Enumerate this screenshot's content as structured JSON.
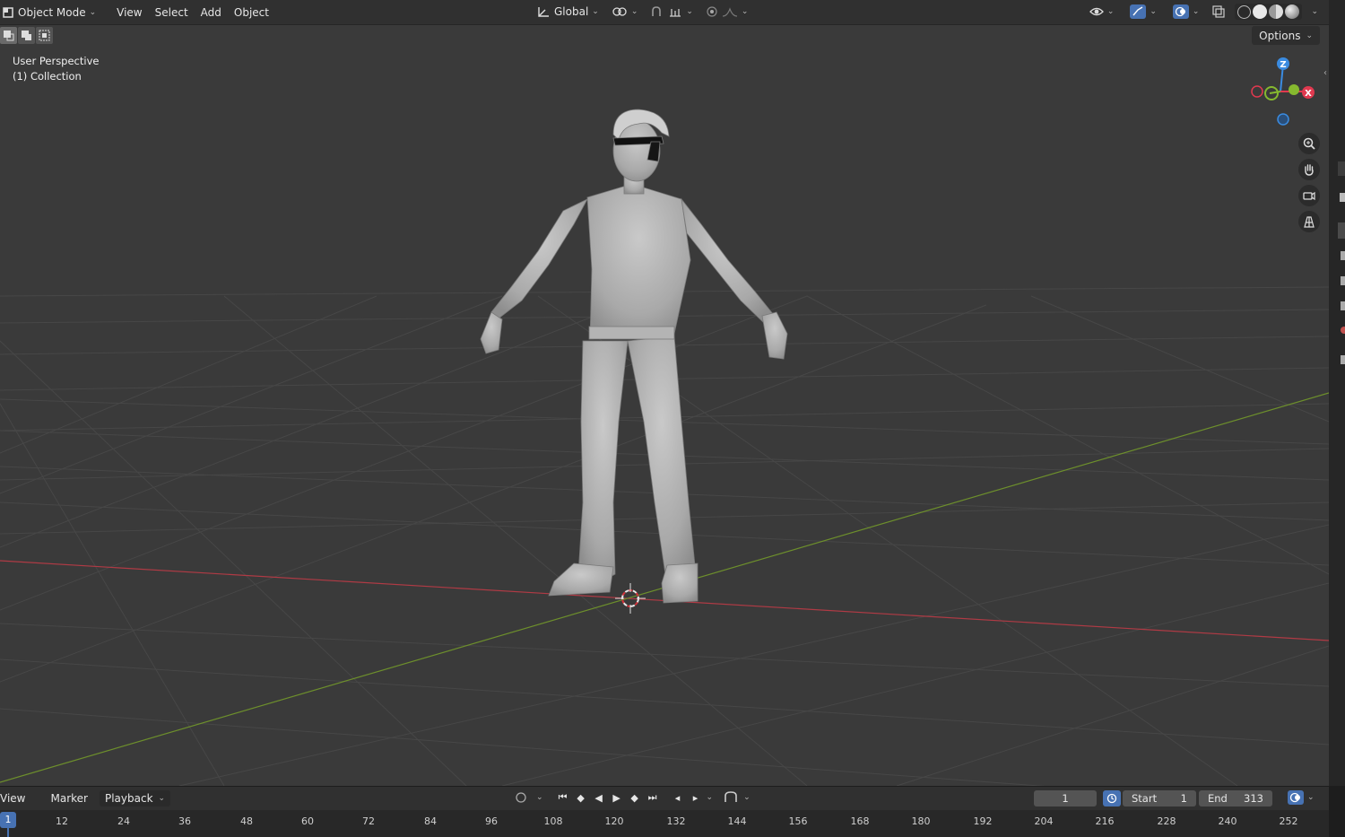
{
  "header": {
    "mode_label": "Object Mode",
    "menus": [
      "View",
      "Select",
      "Add",
      "Object"
    ],
    "transform_orientation": "Global"
  },
  "options_label": "Options",
  "viewport_info": {
    "perspective": "User Perspective",
    "collection": "(1) Collection"
  },
  "gizmo": {
    "z": "Z",
    "x": "X"
  },
  "colors": {
    "x_axis": "#e0394f",
    "y_axis": "#86b92f",
    "z_axis": "#3a8be0",
    "accent": "#4772b3"
  },
  "icons": [
    "cube-icon",
    "transform-orientation-icon",
    "pivot-icon",
    "snap-icon",
    "proportional-edit-icon",
    "visibility-icon",
    "gizmo-icon",
    "overlay-icon",
    "xray-icon",
    "zoom-icon",
    "pan-hand-icon",
    "camera-icon",
    "ortho-grid-icon",
    "clock-icon"
  ],
  "timeline": {
    "menus": [
      "View",
      "Marker"
    ],
    "playback_label": "Playback",
    "current_frame": "1",
    "start_label": "Start",
    "start_value": "1",
    "end_label": "End",
    "end_value": "313",
    "ruler_ticks": [
      "12",
      "24",
      "36",
      "48",
      "60",
      "72",
      "84",
      "96",
      "108",
      "120",
      "132",
      "144",
      "156",
      "168",
      "180",
      "192",
      "204",
      "216",
      "228",
      "240",
      "252"
    ],
    "playhead_label": "1"
  }
}
